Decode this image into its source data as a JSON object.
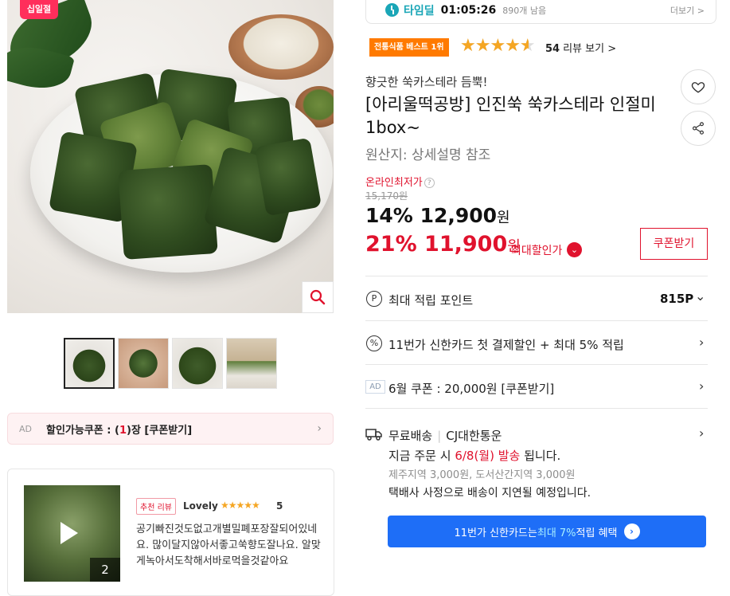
{
  "product_image": {
    "badge_label": "십일절"
  },
  "thumbnails_count": 4,
  "coupon_banner": {
    "ad_label": "AD",
    "text_prefix": "할인가능쿠폰 : (",
    "count": "1",
    "text_suffix": ")장 [쿠폰받기]"
  },
  "review_preview": {
    "video_count": "2",
    "tag": "추천 리뷰",
    "author": "Lovely",
    "stars": "★★★★★",
    "score": "5",
    "text": "공기빠진것도없고개별밀폐포장잘되어있네요. 많이달지않아서좋고쑥향도잘나요. 알맞게녹아서도착해서바로먹을것같아요"
  },
  "timedeal": {
    "label": "타임딜",
    "time": "01:05:26",
    "remaining": "890개 남음",
    "more_label": "더보기 >"
  },
  "rating": {
    "badge": "전통식품 베스트 1위",
    "stars": "★★★★★",
    "score_value": 4.5,
    "review_count": "54",
    "review_link_label": "리뷰 보기 >"
  },
  "product": {
    "subtitle": "향긋한 쑥카스테라 듬뿍!",
    "title": "[아리울떡공방] 인진쑥 쑥카스테라 인절미 1box~",
    "origin": "원산지:  상세설명 참조"
  },
  "price": {
    "lowest_label": "온라인최저가",
    "lowest_help": "?",
    "original": "15,170원",
    "discount1_pct": "14%",
    "discount1_price": "12,900",
    "currency": "원",
    "discount2_pct": "21%",
    "discount2_price": "11,900",
    "max_discount_label": "최대할인가",
    "coupon_button": "쿠폰받기"
  },
  "benefits": {
    "points_label": "최대 적립 포인트",
    "points_value": "815P",
    "card_label": "11번가 신한카드 첫 결제할인 + 최대 5% 적립",
    "ad_label": "AD",
    "coupon_label": "6월 쿠폰 : 20,000원 [쿠폰받기]"
  },
  "shipping": {
    "free_label": "무료배송",
    "carrier": "CJ대한통운",
    "order_prefix": "지금 주문 시 ",
    "date": "6/8(월) 발송",
    "order_suffix": " 됩니다.",
    "extra_fee": "제주지역 3,000원, 도서산간지역 3,000원",
    "notice": "택배사 사정으로 배송이 지연될 예정입니다."
  },
  "card_banner": {
    "prefix": "11번가 신한카드는 ",
    "highlight": "최대 7%",
    "suffix": " 적립 혜택",
    "arrow": "›"
  },
  "colors": {
    "accent_red": "#e0122d",
    "timedeal_teal": "#1aa6b7",
    "badge_orange": "#ff7a00",
    "card_blue": "#1e6ef7",
    "star_gold": "#f5a623"
  }
}
